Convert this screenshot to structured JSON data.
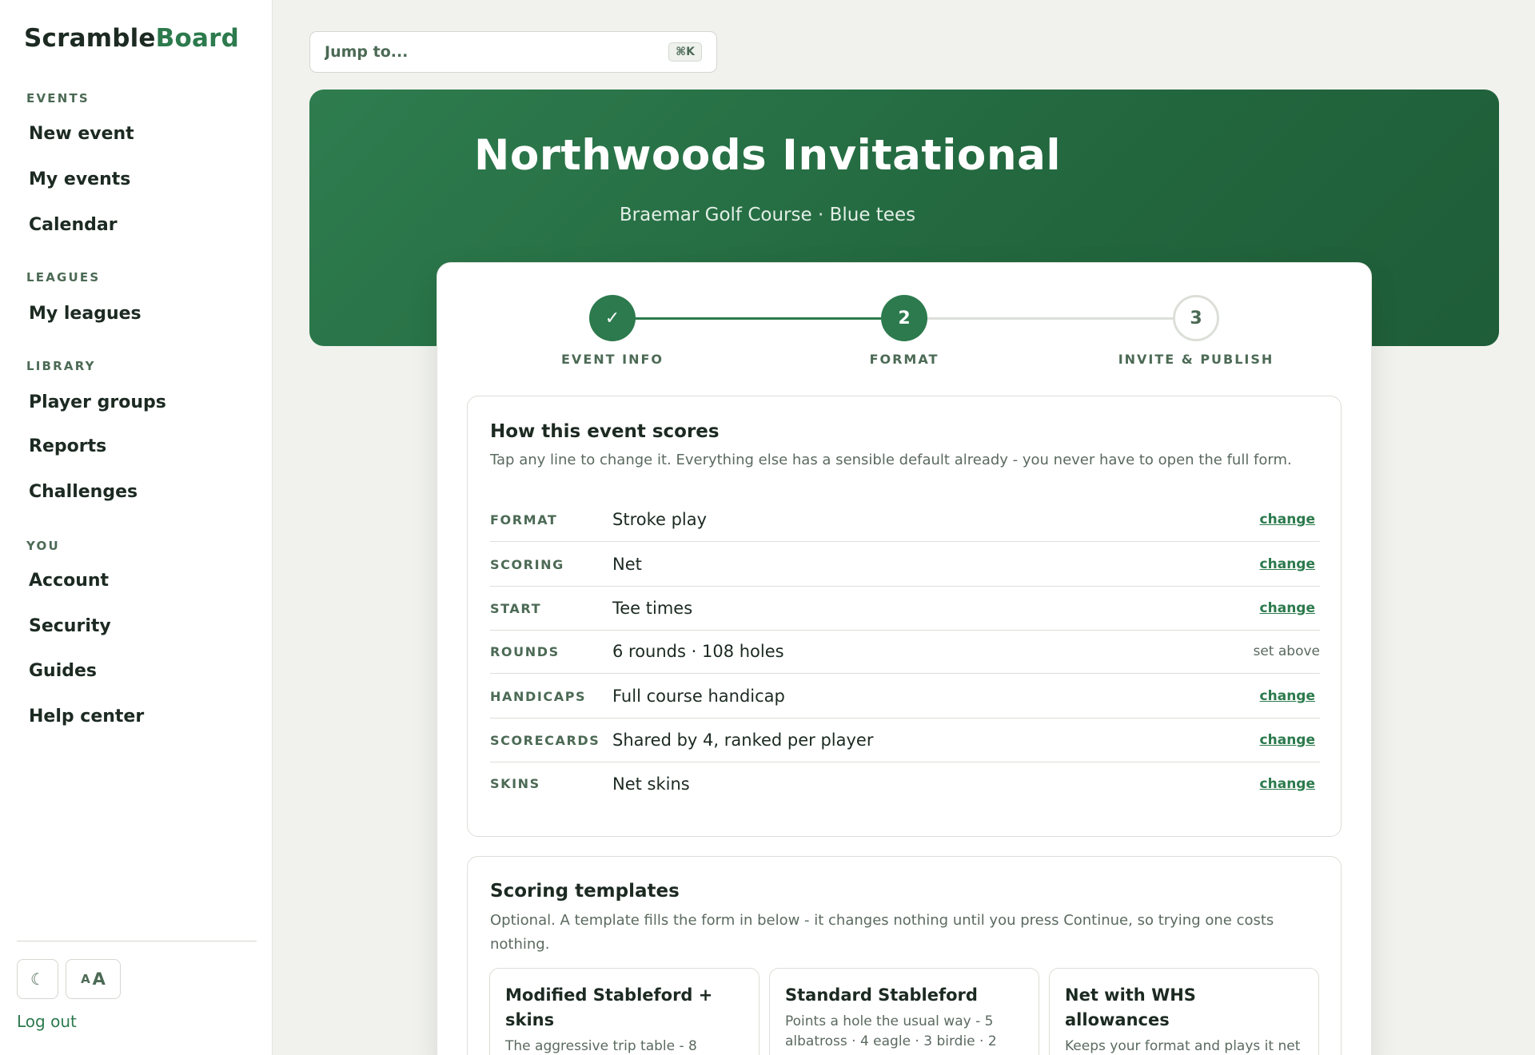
{
  "sidebar": {
    "brand": {
      "part1": "Scramble",
      "part2": "Board"
    },
    "sections": [
      {
        "title": "EVENTS",
        "items": [
          "New event",
          "My events",
          "Calendar"
        ]
      },
      {
        "title": "LEAGUES",
        "items": [
          "My leagues"
        ]
      },
      {
        "title": "LIBRARY",
        "items": [
          "Player groups",
          "Reports",
          "Challenges"
        ]
      },
      {
        "title": "YOU",
        "items": [
          "Account",
          "Security",
          "Guides",
          "Help center"
        ]
      }
    ],
    "theme_icon": "☾",
    "text_size": {
      "small": "A",
      "big": "A"
    },
    "logout": "Log out"
  },
  "search": {
    "placeholder": "Jump to...",
    "shortcut": "⌘K"
  },
  "hero": {
    "title": "Northwoods Invitational",
    "subtitle": "Braemar Golf Course · Blue tees"
  },
  "stepper": {
    "steps": [
      {
        "label": "EVENT INFO",
        "marker": "✓",
        "state": "done"
      },
      {
        "label": "FORMAT",
        "marker": "2",
        "state": "current"
      },
      {
        "label": "INVITE & PUBLISH",
        "marker": "3",
        "state": "pending"
      }
    ]
  },
  "scoring_panel": {
    "title": "How this event scores",
    "description": "Tap any line to change it. Everything else has a sensible default already - you never have to open the full form.",
    "rows": [
      {
        "label": "FORMAT",
        "value": "Stroke play",
        "action": "change"
      },
      {
        "label": "SCORING",
        "value": "Net",
        "action": "change"
      },
      {
        "label": "START",
        "value": "Tee times",
        "action": "change"
      },
      {
        "label": "ROUNDS",
        "value": "6 rounds · 108 holes",
        "note": "set above"
      },
      {
        "label": "HANDICAPS",
        "value": "Full course handicap",
        "action": "change"
      },
      {
        "label": "SCORECARDS",
        "value": "Shared by 4, ranked per player",
        "action": "change"
      },
      {
        "label": "SKINS",
        "value": "Net skins",
        "action": "change"
      }
    ]
  },
  "templates_panel": {
    "title": "Scoring templates",
    "description": "Optional. A template fills the form in below - it changes nothing until you press Continue, so trying one costs nothing.",
    "templates": [
      {
        "title": "Modified Stableford + skins",
        "description": "The aggressive trip table - 8"
      },
      {
        "title": "Standard Stableford",
        "description": "Points a hole the usual way - 5 albatross · 4 eagle · 3 birdie · 2"
      },
      {
        "title": "Net with WHS allowances",
        "description": "Keeps your format and plays it net at the WHS playing handicap"
      }
    ]
  },
  "colors": {
    "accent": "#2c7a4d",
    "hero_start": "#2e7d4f",
    "hero_end": "#1e5d38",
    "background": "#f1f2ee",
    "muted_label": "#4c6a55"
  }
}
